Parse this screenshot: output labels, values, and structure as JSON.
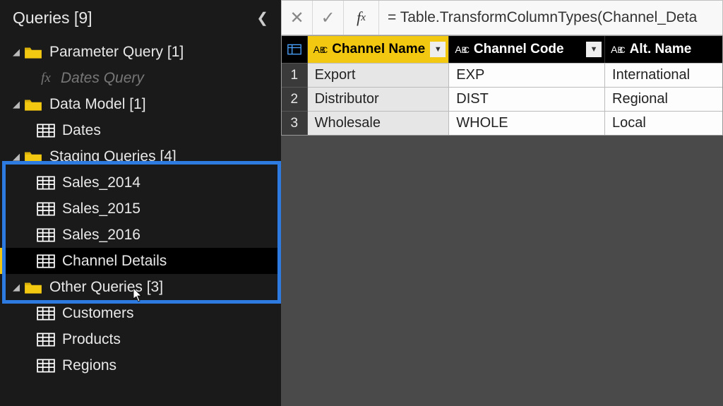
{
  "sidebar": {
    "title": "Queries [9]",
    "groups": [
      {
        "label": "Parameter Query [1]",
        "children": [
          {
            "label": "Dates Query",
            "type": "fx",
            "disabled": true
          }
        ]
      },
      {
        "label": "Data Model [1]",
        "children": [
          {
            "label": "Dates",
            "type": "table"
          }
        ]
      },
      {
        "label": "Staging Queries [4]",
        "children": [
          {
            "label": "Sales_2014",
            "type": "table"
          },
          {
            "label": "Sales_2015",
            "type": "table"
          },
          {
            "label": "Sales_2016",
            "type": "table"
          },
          {
            "label": "Channel Details",
            "type": "table",
            "selected": true
          }
        ]
      },
      {
        "label": "Other Queries [3]",
        "children": [
          {
            "label": "Customers",
            "type": "table"
          },
          {
            "label": "Products",
            "type": "table"
          },
          {
            "label": "Regions",
            "type": "table"
          }
        ]
      }
    ]
  },
  "formula_bar": {
    "value": "= Table.TransformColumnTypes(Channel_Deta"
  },
  "grid": {
    "columns": [
      {
        "name": "Channel Name",
        "selected": true
      },
      {
        "name": "Channel Code",
        "selected": false
      },
      {
        "name": "Alt. Name",
        "selected": false
      }
    ],
    "rows": [
      {
        "n": "1",
        "cells": [
          "Export",
          "EXP",
          "International"
        ]
      },
      {
        "n": "2",
        "cells": [
          "Distributor",
          "DIST",
          "Regional"
        ]
      },
      {
        "n": "3",
        "cells": [
          "Wholesale",
          "WHOLE",
          "Local"
        ]
      }
    ]
  }
}
